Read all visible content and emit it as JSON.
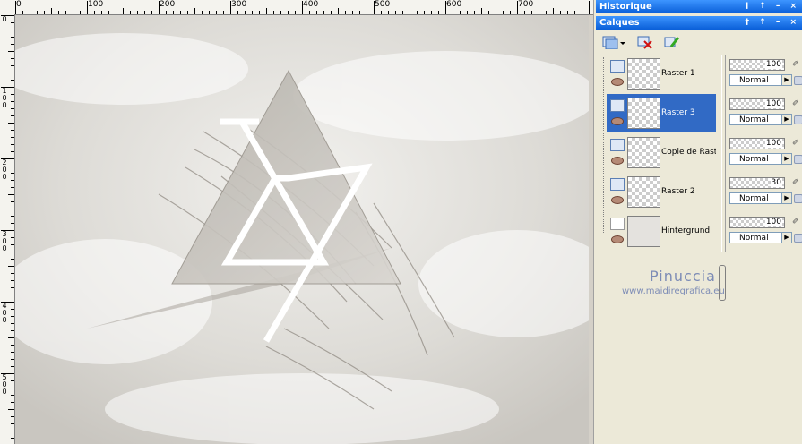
{
  "ruler": {
    "top": [
      "0",
      "100",
      "200",
      "300",
      "400",
      "500",
      "600",
      "700"
    ],
    "left": [
      "0",
      "100",
      "200",
      "300",
      "400",
      "500"
    ]
  },
  "panels": {
    "historique": "Historique",
    "calques": "Calques",
    "controls": "† ↑ – ×"
  },
  "layers": [
    {
      "name": "Raster 1",
      "selected": false
    },
    {
      "name": "Raster 3",
      "selected": true
    },
    {
      "name": "Copie de Raster",
      "selected": false
    },
    {
      "name": "Raster 2",
      "selected": false
    },
    {
      "name": "Hintergrund",
      "selected": false
    }
  ],
  "props": [
    {
      "opacity": "100",
      "blend": "Normal"
    },
    {
      "opacity": "100",
      "blend": "Normal"
    },
    {
      "opacity": "100",
      "blend": "Normal"
    },
    {
      "opacity": "30",
      "blend": "Normal"
    },
    {
      "opacity": "100",
      "blend": "Normal"
    }
  ],
  "watermark": {
    "name": "Pinuccia",
    "url": "www.maidiregrafica.eu"
  },
  "colors": {
    "titlebar": "#0a5fd8",
    "selection": "#316ac5",
    "panel": "#ece9d8"
  }
}
